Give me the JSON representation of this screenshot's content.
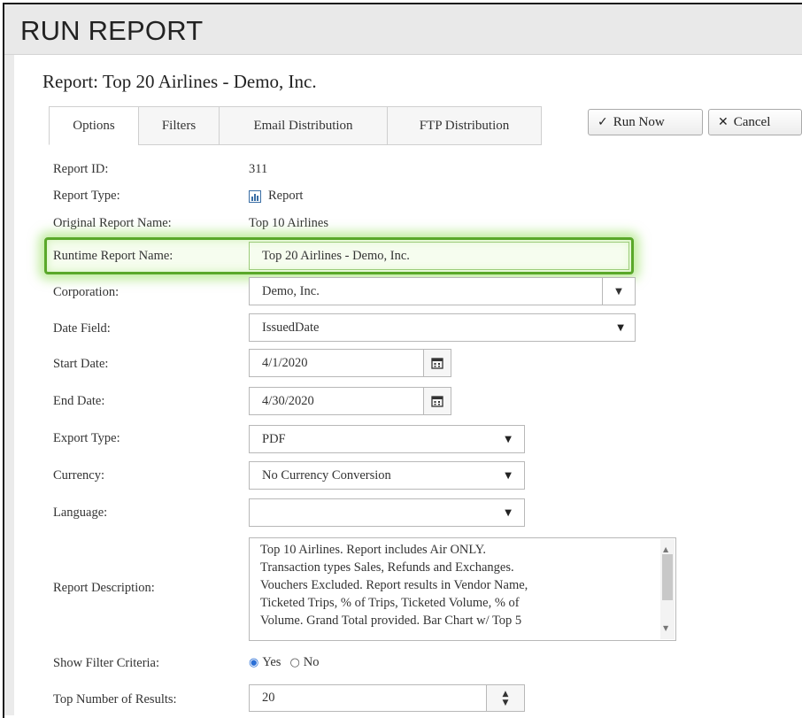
{
  "page": {
    "title": "RUN REPORT"
  },
  "report": {
    "heading": "Report:  Top 20 Airlines - Demo, Inc."
  },
  "tabs": [
    {
      "label": "Options",
      "active": true
    },
    {
      "label": "Filters"
    },
    {
      "label": "Email Distribution"
    },
    {
      "label": "FTP Distribution"
    }
  ],
  "actions": {
    "run_label": "Run Now",
    "cancel_label": "Cancel"
  },
  "fields": {
    "report_id": {
      "label": "Report ID:",
      "value": "311"
    },
    "report_type": {
      "label": "Report Type:",
      "value": "Report",
      "icon": "bar-chart-icon"
    },
    "original_name": {
      "label": "Original Report Name:",
      "value": "Top 10 Airlines"
    },
    "runtime_name": {
      "label": "Runtime Report Name:",
      "value": "Top 20 Airlines - Demo, Inc."
    },
    "corporation": {
      "label": "Corporation:",
      "value": "Demo, Inc."
    },
    "date_field": {
      "label": "Date Field:",
      "value": "IssuedDate"
    },
    "start_date": {
      "label": "Start Date:",
      "value": "4/1/2020"
    },
    "end_date": {
      "label": "End Date:",
      "value": "4/30/2020"
    },
    "export_type": {
      "label": "Export Type:",
      "value": "PDF"
    },
    "currency": {
      "label": "Currency:",
      "value": "No Currency Conversion"
    },
    "language": {
      "label": "Language:",
      "value": ""
    },
    "description": {
      "label": "Report Description:",
      "lines": [
        "Top 10 Airlines.  Report includes Air ONLY.",
        "Transaction types Sales, Refunds and Exchanges.",
        "Vouchers Excluded.  Report results in Vendor Name,",
        "Ticketed Trips, % of Trips, Ticketed Volume, % of",
        "Volume.  Grand Total provided.  Bar Chart w/ Top 5"
      ]
    },
    "show_filter": {
      "label": "Show Filter Criteria:",
      "yes": "Yes",
      "no": "No",
      "selected": "Yes"
    },
    "top_number": {
      "label": "Top Number of Results:",
      "value": "20"
    }
  },
  "colors": {
    "highlight": "#5aa82a"
  }
}
